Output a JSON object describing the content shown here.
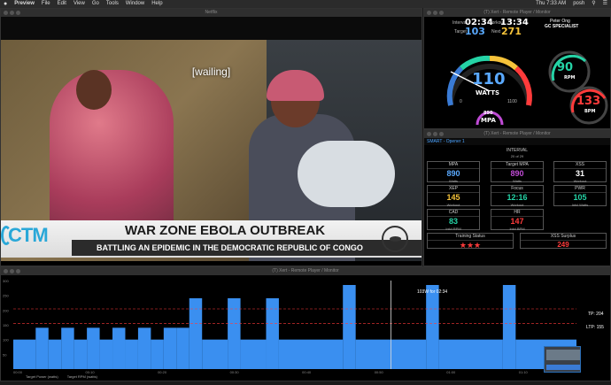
{
  "menubar": {
    "apple": "",
    "app_name": "Preview",
    "items": [
      "File",
      "Edit",
      "View",
      "Go",
      "Tools",
      "Window",
      "Help"
    ],
    "clock": "Thu 7:33 AM",
    "user": "posh"
  },
  "video_window": {
    "title": "Netflix",
    "caption": "[wailing]",
    "network": "CTM",
    "headline": "WAR ZONE EBOLA OUTBREAK",
    "subline": "BATTLING AN EPIDEMIC IN THE DEMOCRATIC REPUBLIC OF CONGO"
  },
  "gauge_window": {
    "title": "(T) Xert - Remote Player / Monitor",
    "interval_label": "Interval",
    "interval_value": "02:34",
    "workout_label": "Workout",
    "workout_value": "13:34",
    "target_label": "Target",
    "target_value": "103",
    "next_label": "Next",
    "next_value": "271",
    "athlete_name": "Peter Ong",
    "athlete_type": "GC SPECIALIST",
    "watts_value": "110",
    "watts_label": "WATTS",
    "dial_min": "0",
    "dial_max": "1100",
    "mpa_value": "890",
    "mpa_label": "MPA",
    "rpm_value": "90",
    "rpm_label": "RPM",
    "bpm_value": "133",
    "bpm_label": "BPM",
    "colors": {
      "watts": "#5aa9ff",
      "rpm": "#25d3a6",
      "bpm": "#ff3b3b",
      "mpa": "#c04bd6",
      "target": "#5aa9ff",
      "next": "#f6c33a"
    }
  },
  "smart_window": {
    "title": "(T) Xert - Remote Player / Monitor",
    "header": "SMART - Opener 1",
    "interval_label": "INTERVAL",
    "interval_count": "20 of 29",
    "boxes": [
      {
        "title": "MPA",
        "value": "890",
        "sub": "Watts",
        "color": "#5aa9ff"
      },
      {
        "title": "Target MPA",
        "value": "890",
        "sub": "Watts",
        "color": "#c04bd6"
      },
      {
        "title": "XSS",
        "value": "31",
        "sub": "Workout",
        "color": "#ffffff"
      },
      {
        "title": "XEP",
        "value": "145",
        "sub": "Workout",
        "color": "#f6c33a"
      },
      {
        "title": "Focus",
        "value": "12:16",
        "sub": "Workout",
        "color": "#25d3a6"
      },
      {
        "title": "PWR",
        "value": "105",
        "sub": "Intvl Watts",
        "color": "#25d3a6"
      },
      {
        "title": "CAD",
        "value": "83",
        "sub": "Intvl RPM",
        "color": "#25d3a6"
      },
      {
        "title": "HR",
        "value": "147",
        "sub": "Intvl BPM",
        "color": "#ff3b3b"
      }
    ],
    "training_status_label": "Training Status",
    "stars": "★★★",
    "xss_surplus_label": "XSS Surplus",
    "xss_surplus_value": "249"
  },
  "chart_window": {
    "title": "(T) Xert - Remote Player / Monitor",
    "tooltip": "103W for 02:34",
    "tp_label": "TP: 204",
    "ltp_label": "LTP: 155",
    "legend": [
      "Target Power (watts)",
      "Target RPM (watts)"
    ]
  },
  "chart_data": {
    "type": "bar",
    "ylim": [
      0,
      300
    ],
    "yticks": [
      "300",
      "250",
      "200",
      "150",
      "100",
      "50"
    ],
    "xticks": [
      "00:00",
      "00:10",
      "00:20",
      "00:30",
      "00:40",
      "00:50",
      "01:00",
      "01:10"
    ],
    "threshold_lines": [
      {
        "name": "TP",
        "value": 204,
        "color": "#ff3b3b"
      },
      {
        "name": "LTP",
        "value": 155,
        "color": "#ff3b3b"
      }
    ],
    "segments": [
      {
        "start": 0,
        "end": 3.5,
        "value": 100
      },
      {
        "start": 3.5,
        "end": 5.5,
        "value": 140
      },
      {
        "start": 5.5,
        "end": 7.5,
        "value": 100
      },
      {
        "start": 7.5,
        "end": 9.5,
        "value": 140
      },
      {
        "start": 9.5,
        "end": 11.5,
        "value": 100
      },
      {
        "start": 11.5,
        "end": 13.5,
        "value": 140
      },
      {
        "start": 13.5,
        "end": 15.5,
        "value": 100
      },
      {
        "start": 15.5,
        "end": 17.5,
        "value": 140
      },
      {
        "start": 17.5,
        "end": 19.5,
        "value": 100
      },
      {
        "start": 19.5,
        "end": 21.5,
        "value": 140
      },
      {
        "start": 21.5,
        "end": 23.5,
        "value": 100
      },
      {
        "start": 23.5,
        "end": 25.5,
        "value": 140
      },
      {
        "start": 25.5,
        "end": 27.5,
        "value": 140
      },
      {
        "start": 27.5,
        "end": 29.5,
        "value": 240
      },
      {
        "start": 29.5,
        "end": 33.5,
        "value": 100
      },
      {
        "start": 33.5,
        "end": 35.5,
        "value": 240
      },
      {
        "start": 35.5,
        "end": 39.5,
        "value": 100
      },
      {
        "start": 39.5,
        "end": 41.5,
        "value": 240
      },
      {
        "start": 41.5,
        "end": 51.5,
        "value": 100
      },
      {
        "start": 51.5,
        "end": 53.5,
        "value": 285
      },
      {
        "start": 53.5,
        "end": 64.5,
        "value": 100
      },
      {
        "start": 64.5,
        "end": 66.5,
        "value": 285
      },
      {
        "start": 66.5,
        "end": 76.5,
        "value": 100
      },
      {
        "start": 76.5,
        "end": 78.5,
        "value": 285
      },
      {
        "start": 78.5,
        "end": 88,
        "value": 100
      }
    ],
    "current_position": 59,
    "x_max": 88
  }
}
